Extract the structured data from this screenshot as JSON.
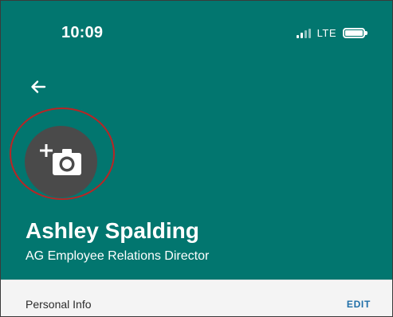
{
  "status_bar": {
    "time": "10:09",
    "network": "LTE"
  },
  "profile": {
    "name": "Ashley Spalding",
    "role": "AG Employee Relations Director"
  },
  "section": {
    "title": "Personal Info",
    "edit_label": "EDIT"
  },
  "icons": {
    "back": "arrow-left-icon",
    "add_photo": "add-photo-camera-icon",
    "signal": "signal-bars-icon",
    "battery": "battery-icon"
  },
  "colors": {
    "header_bg": "#02766f",
    "avatar_bg": "#4a4a4a",
    "highlight_ring": "#b82525",
    "edit_link": "#1f6fa8",
    "section_bg": "#f4f4f4"
  }
}
